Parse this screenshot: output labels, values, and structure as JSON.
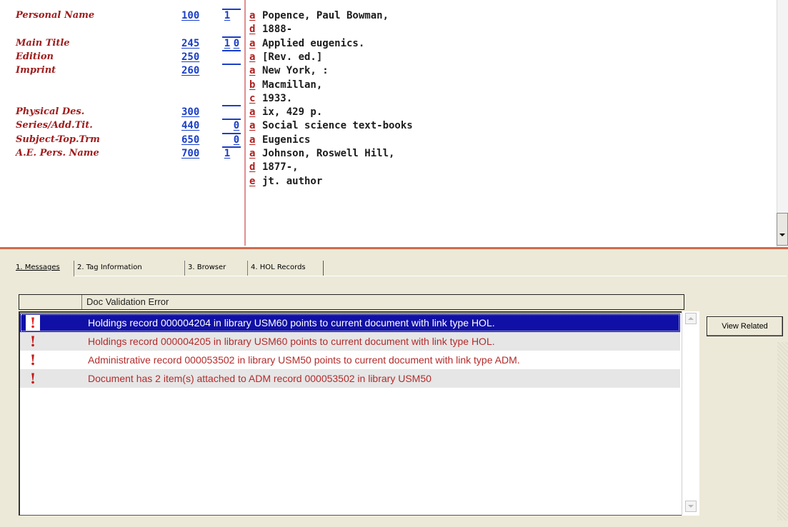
{
  "record": {
    "fields": [
      {
        "label": "Personal Name",
        "tag": "100",
        "ind1": "1",
        "ind2": "",
        "subfields": [
          {
            "code": "a",
            "value": "Popence, Paul Bowman,"
          },
          {
            "code": "d",
            "value": "1888-"
          }
        ]
      },
      {
        "label": "Main Title",
        "tag": "245",
        "ind1": "1",
        "ind2": "0",
        "subfields": [
          {
            "code": "a",
            "value": "Applied eugenics."
          }
        ]
      },
      {
        "label": "Edition",
        "tag": "250",
        "ind1": "",
        "ind2": "",
        "subfields": [
          {
            "code": "a",
            "value": "[Rev. ed.]"
          }
        ]
      },
      {
        "label": "Imprint",
        "tag": "260",
        "ind1": "",
        "ind2": "",
        "subfields": [
          {
            "code": "a",
            "value": "New York, :"
          },
          {
            "code": "b",
            "value": "Macmillan,"
          },
          {
            "code": "c",
            "value": "1933."
          }
        ]
      },
      {
        "label": "Physical Des.",
        "tag": "300",
        "ind1": "",
        "ind2": "",
        "subfields": [
          {
            "code": "a",
            "value": "ix, 429 p."
          }
        ]
      },
      {
        "label": "Series/Add.Tit.",
        "tag": "440",
        "ind1": "",
        "ind2": "0",
        "subfields": [
          {
            "code": "a",
            "value": "Social science text-books"
          }
        ]
      },
      {
        "label": "Subject-Top.Trm",
        "tag": "650",
        "ind1": "",
        "ind2": "0",
        "subfields": [
          {
            "code": "a",
            "value": "Eugenics"
          }
        ]
      },
      {
        "label": "A.E. Pers. Name",
        "tag": "700",
        "ind1": "1",
        "ind2": "",
        "subfields": [
          {
            "code": "a",
            "value": "Johnson, Roswell Hill,"
          },
          {
            "code": "d",
            "value": "1877-,"
          },
          {
            "code": "e",
            "value": "jt. author"
          }
        ]
      }
    ]
  },
  "tabs": [
    {
      "label": "1. Messages",
      "active": true
    },
    {
      "label": "2. Tag Information",
      "active": false
    },
    {
      "label": "3. Browser",
      "active": false
    },
    {
      "label": "4. HOL Records",
      "active": false
    }
  ],
  "messages": {
    "column_header": "Doc Validation Error",
    "icon": "exclamation-icon",
    "rows": [
      {
        "text": "Holdings record 000004204 in library USM60 points to current document with link type HOL.",
        "selected": true
      },
      {
        "text": "Holdings record 000004205 in library USM60 points to current document with link type HOL.",
        "selected": false
      },
      {
        "text": "Administrative record 000053502 in library USM50 points to current document with link type ADM.",
        "selected": false
      },
      {
        "text": "Document has 2 item(s) attached to ADM record 000053502 in library USM50",
        "selected": false
      }
    ]
  },
  "buttons": {
    "view_related": "View Related"
  },
  "colors": {
    "label": "#a01c1c",
    "tag": "#1a3fc8",
    "subfield_code": "#b02020",
    "message_text": "#b42b2b",
    "selection": "#1010a6",
    "divider": "#cf6b4c"
  }
}
